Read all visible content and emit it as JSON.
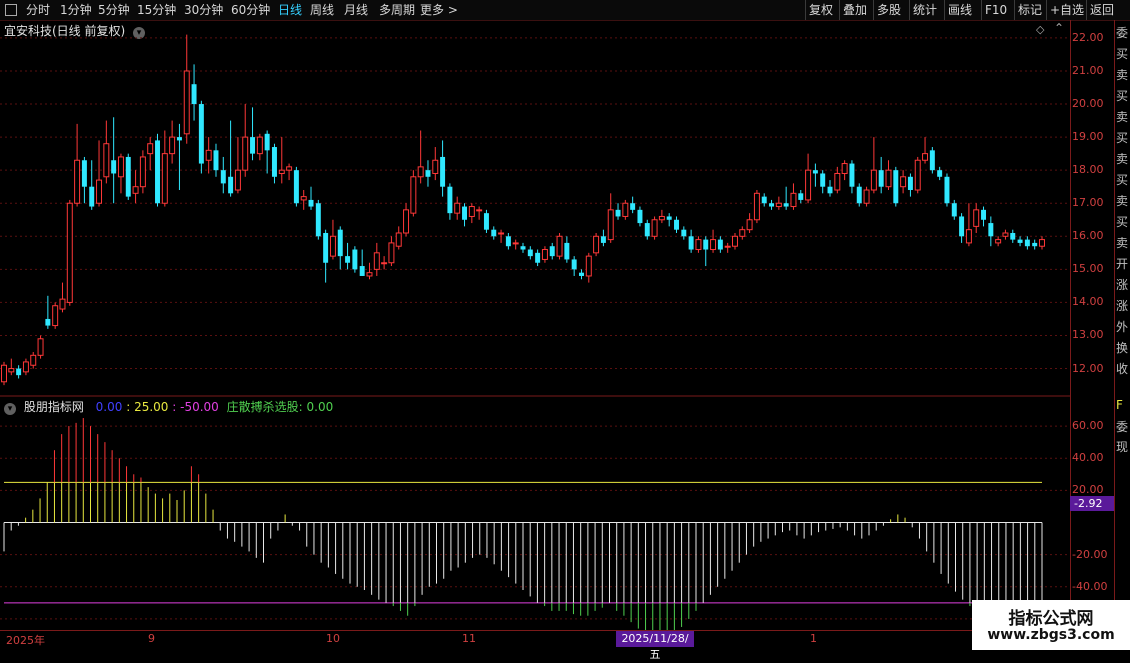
{
  "toolbar": {
    "periods": [
      {
        "label": "分时",
        "active": false
      },
      {
        "label": "1分钟",
        "active": false
      },
      {
        "label": "5分钟",
        "active": false
      },
      {
        "label": "15分钟",
        "active": false
      },
      {
        "label": "30分钟",
        "active": false
      },
      {
        "label": "60分钟",
        "active": false
      },
      {
        "label": "日线",
        "active": true
      },
      {
        "label": "周线",
        "active": false
      },
      {
        "label": "月线",
        "active": false
      },
      {
        "label": "多周期",
        "active": false
      },
      {
        "label": "更多 >",
        "active": false
      }
    ],
    "actions": [
      "复权",
      "叠加",
      "多股",
      "统计",
      "画线",
      "F10",
      "标记",
      "+自选",
      "返回"
    ]
  },
  "chart": {
    "title": "宜安科技(日线 前复权)",
    "price_ticks": [
      "22.00",
      "21.00",
      "20.00",
      "19.00",
      "18.00",
      "17.00",
      "16.00",
      "15.00",
      "14.00",
      "13.00",
      "12.00"
    ],
    "indicator_ticks": [
      "60.00",
      "40.00",
      "20.00",
      "-20.00",
      "-40.00",
      "-60.00"
    ],
    "indicator_current": "-2.92",
    "right_edge_chars": [
      "委",
      "买",
      "卖",
      "买",
      "卖",
      "买",
      "卖",
      "买",
      "卖",
      "买",
      "卖",
      "开",
      "涨",
      "涨",
      "外",
      "换",
      "收"
    ],
    "indicator_edge_chars": [
      "F",
      "委",
      "现"
    ]
  },
  "indicator": {
    "name": "股朋指标网",
    "v1": "0.00",
    "v2": ": 25.00",
    "v3": ": -50.00",
    "v4_label": "庄散搏杀选股",
    "v4": ": 0.00"
  },
  "time_axis": {
    "labels": [
      "2025年",
      "9",
      "10",
      "11",
      "1",
      "1"
    ],
    "selected_date": "2025/11/28/五"
  },
  "watermark": {
    "title": "指标公式网",
    "url": "www.zbgs3.com"
  },
  "colors": {
    "up": "#ff3838",
    "down": "#30e8ff",
    "yellow": "#e8e840",
    "magenta": "#e040e0",
    "green": "#50d050",
    "white": "#e8e8e8"
  },
  "chart_data": {
    "type": "candlestick",
    "price_range": [
      11.2,
      22.3
    ],
    "indicator_range": [
      -70,
      70
    ],
    "upper_line": 25,
    "lower_line": -50,
    "candles": [
      [
        11.6,
        12.1,
        11.5,
        12.2
      ],
      [
        11.9,
        12.0,
        11.8,
        12.3
      ],
      [
        12.0,
        11.8,
        11.7,
        12.1
      ],
      [
        11.9,
        12.2,
        11.8,
        12.3
      ],
      [
        12.1,
        12.4,
        12.0,
        12.5
      ],
      [
        12.4,
        12.9,
        12.3,
        13.0
      ],
      [
        13.5,
        13.3,
        13.2,
        14.2
      ],
      [
        13.3,
        13.9,
        13.2,
        14.0
      ],
      [
        13.8,
        14.1,
        13.7,
        14.6
      ],
      [
        14.0,
        17.0,
        13.9,
        17.1
      ],
      [
        17.0,
        18.3,
        16.9,
        19.4
      ],
      [
        18.3,
        17.5,
        17.0,
        18.4
      ],
      [
        17.5,
        16.9,
        16.8,
        18.3
      ],
      [
        17.0,
        17.7,
        16.9,
        18.9
      ],
      [
        17.8,
        18.8,
        17.6,
        19.5
      ],
      [
        18.3,
        17.9,
        17.0,
        19.6
      ],
      [
        17.8,
        18.4,
        17.3,
        18.5
      ],
      [
        18.4,
        17.2,
        17.1,
        18.5
      ],
      [
        17.3,
        17.5,
        17.0,
        18.0
      ],
      [
        17.5,
        18.4,
        17.3,
        18.6
      ],
      [
        18.5,
        18.8,
        18.0,
        19.0
      ],
      [
        18.9,
        17.0,
        16.9,
        19.1
      ],
      [
        17.0,
        18.5,
        16.9,
        19.2
      ],
      [
        18.5,
        19.0,
        18.2,
        19.5
      ],
      [
        19.0,
        18.9,
        17.4,
        19.4
      ],
      [
        19.1,
        21.0,
        18.8,
        22.1
      ],
      [
        20.6,
        20.0,
        19.5,
        21.2
      ],
      [
        20.0,
        18.2,
        17.9,
        20.1
      ],
      [
        18.3,
        18.6,
        17.9,
        19.0
      ],
      [
        18.6,
        18.0,
        17.8,
        18.8
      ],
      [
        18.0,
        17.6,
        17.3,
        18.4
      ],
      [
        17.8,
        17.3,
        17.2,
        19.5
      ],
      [
        17.4,
        18.0,
        17.3,
        19.0
      ],
      [
        18.0,
        19.0,
        17.8,
        20.0
      ],
      [
        19.0,
        18.5,
        18.3,
        19.9
      ],
      [
        18.5,
        19.0,
        18.3,
        19.1
      ],
      [
        19.1,
        18.6,
        17.9,
        19.2
      ],
      [
        18.7,
        17.8,
        17.6,
        18.8
      ],
      [
        17.9,
        18.0,
        17.6,
        19.0
      ],
      [
        18.0,
        18.1,
        17.7,
        18.2
      ],
      [
        18.0,
        17.0,
        16.9,
        18.1
      ],
      [
        17.1,
        17.2,
        16.8,
        17.4
      ],
      [
        17.1,
        16.9,
        16.8,
        17.5
      ],
      [
        17.0,
        16.0,
        15.9,
        17.1
      ],
      [
        16.1,
        15.2,
        14.6,
        16.2
      ],
      [
        15.4,
        16.0,
        15.3,
        16.5
      ],
      [
        16.2,
        15.4,
        15.0,
        16.3
      ],
      [
        15.4,
        15.2,
        15.0,
        15.8
      ],
      [
        15.6,
        15.0,
        14.9,
        15.7
      ],
      [
        15.1,
        14.8,
        14.8,
        15.6
      ],
      [
        14.8,
        14.9,
        14.7,
        15.2
      ],
      [
        15.0,
        15.5,
        14.8,
        15.8
      ],
      [
        15.2,
        15.2,
        15.0,
        15.4
      ],
      [
        15.2,
        15.8,
        15.1,
        16.0
      ],
      [
        15.7,
        16.1,
        15.6,
        16.3
      ],
      [
        16.1,
        16.8,
        16.0,
        17.0
      ],
      [
        16.7,
        17.8,
        16.6,
        18.0
      ],
      [
        17.8,
        18.1,
        17.6,
        19.2
      ],
      [
        18.0,
        17.8,
        17.5,
        18.3
      ],
      [
        17.9,
        18.3,
        17.7,
        18.7
      ],
      [
        18.4,
        17.5,
        17.2,
        18.9
      ],
      [
        17.5,
        16.7,
        16.5,
        17.6
      ],
      [
        16.7,
        17.0,
        16.5,
        17.2
      ],
      [
        16.9,
        16.5,
        16.3,
        17.0
      ],
      [
        16.6,
        16.9,
        16.4,
        17.0
      ],
      [
        16.8,
        16.8,
        16.5,
        16.9
      ],
      [
        16.7,
        16.2,
        16.1,
        16.8
      ],
      [
        16.2,
        16.0,
        15.9,
        16.3
      ],
      [
        16.1,
        16.1,
        15.8,
        16.2
      ],
      [
        16.0,
        15.7,
        15.6,
        16.1
      ],
      [
        15.8,
        15.8,
        15.6,
        15.9
      ],
      [
        15.7,
        15.6,
        15.5,
        15.8
      ],
      [
        15.6,
        15.4,
        15.3,
        15.7
      ],
      [
        15.5,
        15.2,
        15.1,
        15.6
      ],
      [
        15.3,
        15.6,
        15.2,
        15.7
      ],
      [
        15.7,
        15.4,
        15.3,
        15.8
      ],
      [
        15.4,
        16.0,
        15.3,
        16.1
      ],
      [
        15.8,
        15.3,
        15.2,
        16.0
      ],
      [
        15.3,
        15.0,
        14.8,
        15.4
      ],
      [
        14.9,
        14.8,
        14.7,
        15.0
      ],
      [
        14.8,
        15.4,
        14.6,
        15.5
      ],
      [
        15.5,
        16.0,
        15.4,
        16.1
      ],
      [
        16.0,
        15.8,
        15.7,
        16.2
      ],
      [
        15.9,
        16.8,
        15.8,
        17.3
      ],
      [
        16.8,
        16.6,
        16.5,
        17.0
      ],
      [
        16.6,
        17.0,
        16.5,
        17.1
      ],
      [
        17.0,
        16.8,
        16.7,
        17.2
      ],
      [
        16.8,
        16.4,
        16.3,
        16.9
      ],
      [
        16.4,
        16.0,
        15.9,
        16.5
      ],
      [
        16.0,
        16.5,
        15.9,
        16.6
      ],
      [
        16.5,
        16.6,
        16.4,
        16.8
      ],
      [
        16.6,
        16.5,
        16.3,
        16.7
      ],
      [
        16.5,
        16.2,
        16.1,
        16.6
      ],
      [
        16.2,
        16.0,
        15.9,
        16.3
      ],
      [
        16.0,
        15.6,
        15.5,
        16.2
      ],
      [
        15.6,
        15.9,
        15.5,
        16.0
      ],
      [
        15.9,
        15.6,
        15.1,
        16.0
      ],
      [
        15.6,
        15.9,
        15.5,
        16.2
      ],
      [
        15.9,
        15.6,
        15.5,
        16.0
      ],
      [
        15.7,
        15.7,
        15.5,
        15.8
      ],
      [
        15.7,
        16.0,
        15.6,
        16.1
      ],
      [
        16.0,
        16.2,
        15.9,
        16.3
      ],
      [
        16.2,
        16.5,
        16.1,
        16.7
      ],
      [
        16.5,
        17.3,
        16.4,
        17.4
      ],
      [
        17.2,
        17.0,
        16.9,
        17.3
      ],
      [
        17.0,
        16.9,
        16.8,
        17.1
      ],
      [
        16.9,
        17.0,
        16.8,
        17.2
      ],
      [
        17.0,
        16.9,
        16.8,
        17.5
      ],
      [
        16.9,
        17.3,
        16.8,
        17.6
      ],
      [
        17.3,
        17.1,
        17.0,
        17.4
      ],
      [
        17.1,
        18.0,
        17.0,
        18.5
      ],
      [
        18.0,
        17.9,
        17.5,
        18.2
      ],
      [
        17.9,
        17.5,
        17.3,
        18.0
      ],
      [
        17.5,
        17.3,
        17.2,
        17.7
      ],
      [
        17.4,
        17.9,
        17.3,
        18.1
      ],
      [
        17.9,
        18.2,
        17.7,
        18.3
      ],
      [
        18.2,
        17.5,
        17.3,
        18.3
      ],
      [
        17.5,
        17.0,
        16.9,
        17.6
      ],
      [
        17.0,
        17.4,
        16.9,
        17.5
      ],
      [
        17.4,
        18.0,
        17.3,
        19.0
      ],
      [
        18.0,
        17.5,
        17.3,
        18.4
      ],
      [
        17.5,
        18.0,
        17.4,
        18.3
      ],
      [
        18.0,
        17.0,
        16.9,
        18.1
      ],
      [
        17.5,
        17.8,
        17.3,
        18.0
      ],
      [
        17.8,
        17.4,
        17.2,
        17.9
      ],
      [
        17.4,
        18.3,
        17.3,
        18.4
      ],
      [
        18.3,
        18.5,
        18.2,
        19.0
      ],
      [
        18.6,
        18.0,
        17.9,
        18.7
      ],
      [
        18.0,
        17.8,
        17.7,
        18.1
      ],
      [
        17.8,
        17.0,
        16.9,
        17.9
      ],
      [
        17.0,
        16.6,
        16.5,
        17.1
      ],
      [
        16.6,
        16.0,
        15.8,
        16.7
      ],
      [
        15.8,
        16.2,
        15.7,
        17.0
      ],
      [
        16.3,
        16.8,
        16.1,
        17.0
      ],
      [
        16.8,
        16.5,
        16.3,
        16.9
      ],
      [
        16.4,
        16.0,
        15.7,
        16.6
      ],
      [
        15.8,
        15.9,
        15.7,
        16.0
      ],
      [
        16.0,
        16.1,
        15.9,
        16.2
      ],
      [
        16.1,
        15.9,
        15.8,
        16.2
      ],
      [
        15.9,
        15.8,
        15.7,
        16.0
      ],
      [
        15.9,
        15.7,
        15.6,
        16.0
      ],
      [
        15.8,
        15.7,
        15.6,
        15.9
      ],
      [
        15.7,
        15.9,
        15.6,
        16.0
      ]
    ],
    "indicator_values": [
      -18,
      -5,
      -2,
      3,
      8,
      15,
      25,
      45,
      55,
      60,
      62,
      65,
      60,
      55,
      50,
      45,
      40,
      35,
      30,
      28,
      22,
      18,
      15,
      18,
      14,
      20,
      35,
      30,
      18,
      8,
      -5,
      -10,
      -12,
      -15,
      -18,
      -22,
      -25,
      -10,
      -5,
      5,
      -2,
      -5,
      -15,
      -20,
      -25,
      -28,
      -32,
      -35,
      -38,
      -40,
      -42,
      -45,
      -48,
      -50,
      -52,
      -55,
      -58,
      -52,
      -45,
      -40,
      -38,
      -35,
      -30,
      -28,
      -25,
      -22,
      -20,
      -22,
      -26,
      -30,
      -34,
      -38,
      -42,
      -46,
      -50,
      -52,
      -55,
      -55,
      -55,
      -57,
      -58,
      -58,
      -55,
      -53,
      -50,
      -55,
      -58,
      -62,
      -66,
      -70,
      -72,
      -74,
      -75,
      -70,
      -65,
      -60,
      -55,
      -50,
      -45,
      -40,
      -35,
      -30,
      -25,
      -20,
      -15,
      -12,
      -10,
      -8,
      -6,
      -5,
      -8,
      -10,
      -8,
      -6,
      -5,
      -4,
      -3,
      -5,
      -8,
      -10,
      -8,
      -5,
      -2,
      2,
      5,
      3,
      -3,
      -10,
      -18,
      -25,
      -32,
      -38,
      -43,
      -48,
      -52,
      -55,
      -58,
      -60,
      -58,
      -55,
      -56,
      -58,
      -57,
      -58,
      -56
    ]
  }
}
